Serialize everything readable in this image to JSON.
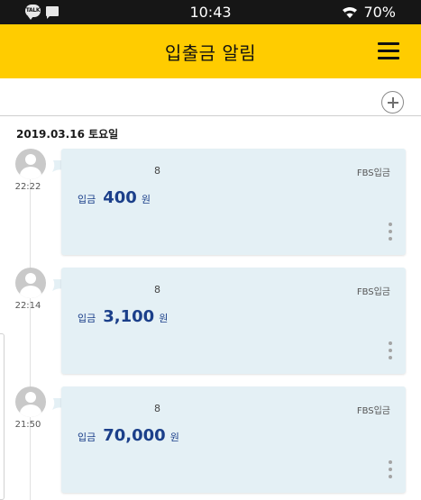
{
  "status_bar": {
    "time": "10:43",
    "battery": "70%",
    "left_icons": [
      "kakaotalk-icon",
      "message-icon"
    ],
    "talk_icon_text": "TALK"
  },
  "header": {
    "title": "입출금 알림",
    "menu_icon": "hamburger-menu-icon",
    "accent_color": "#ffcc00"
  },
  "toolbar": {
    "add_icon": "plus-circle-icon"
  },
  "date_header": "2019.03.16 토요일",
  "entries": [
    {
      "time": "22:22",
      "count": "8",
      "source": "FBS입금",
      "type": "입금",
      "amount": "400",
      "unit": "원"
    },
    {
      "time": "22:14",
      "count": "8",
      "source": "FBS입금",
      "type": "입금",
      "amount": "3,100",
      "unit": "원"
    },
    {
      "time": "21:50",
      "count": "8",
      "source": "FBS입금",
      "type": "입금",
      "amount": "70,000",
      "unit": "원"
    }
  ],
  "colors": {
    "card_background": "#e4f0f5",
    "amount_text": "#1b3f8a"
  }
}
